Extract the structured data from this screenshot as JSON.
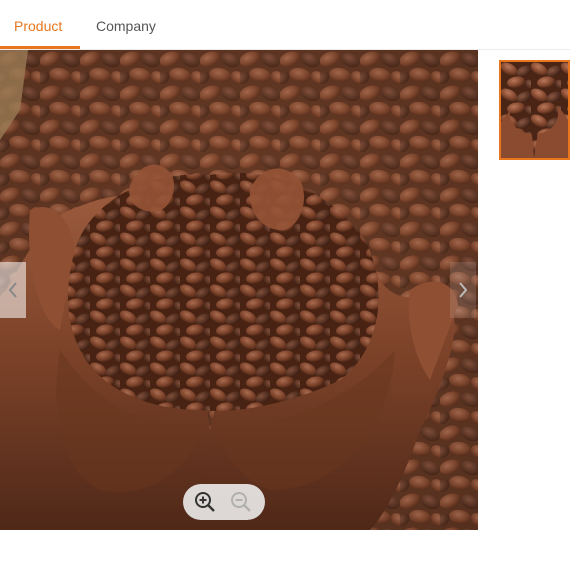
{
  "tabs": [
    {
      "label": "Product",
      "active": true
    },
    {
      "label": "Company",
      "active": false
    }
  ],
  "colors": {
    "accent": "#e8761e"
  },
  "gallery": {
    "main_image": "cocoa-beans-in-hands",
    "zoom_in_icon": "zoom-in-icon",
    "zoom_out_icon": "zoom-out-icon",
    "prev_icon": "chevron-left-icon",
    "next_icon": "chevron-right-icon"
  }
}
